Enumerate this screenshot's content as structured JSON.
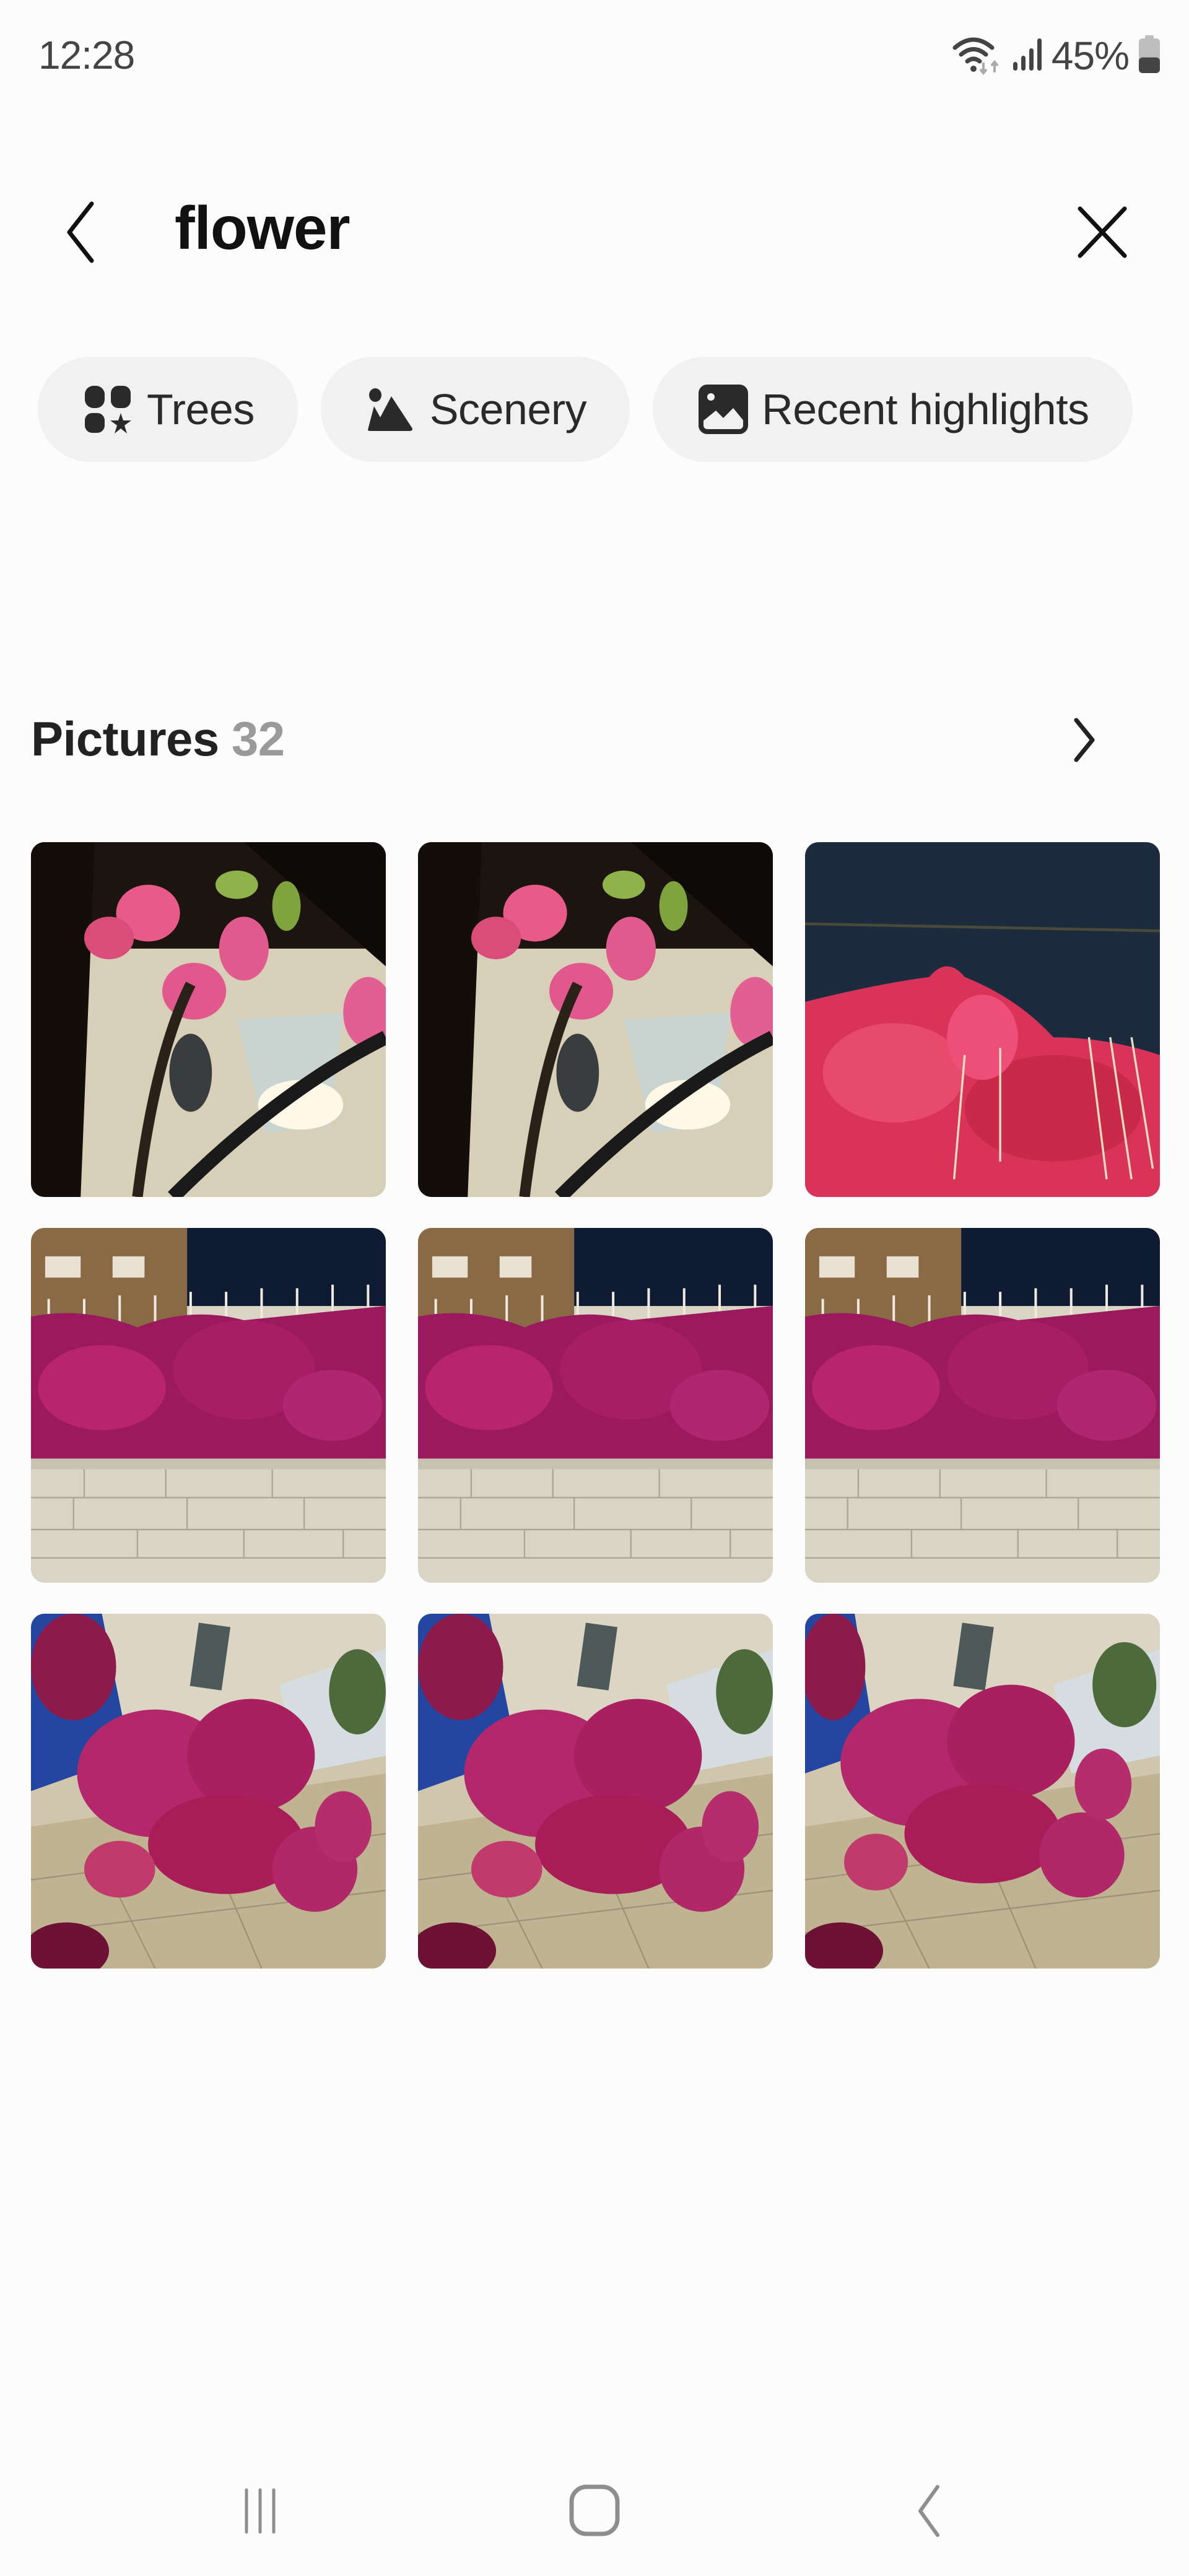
{
  "status_bar": {
    "time": "12:28",
    "battery_percent_label": "45%",
    "battery_level": 0.45,
    "icons": [
      "wifi-icon",
      "data-activity-icon",
      "signal-icon",
      "battery-icon"
    ]
  },
  "header": {
    "back_icon": "chevron-left-icon",
    "search_query": "flower",
    "clear_icon": "close-icon"
  },
  "suggestion_chips": [
    {
      "label": "Trees",
      "icon": "category-icon"
    },
    {
      "label": "Scenery",
      "icon": "landscape-icon"
    },
    {
      "label": "Recent highlights",
      "icon": "picture-icon"
    }
  ],
  "section": {
    "title": "Pictures",
    "count": "32",
    "more_icon": "chevron-right-icon"
  },
  "thumbnails": [
    {
      "subject": "pink bougainvillea by wall lamp at night"
    },
    {
      "subject": "pink bougainvillea by wall lamp at night"
    },
    {
      "subject": "red bougainvillea over fence under night sky"
    },
    {
      "subject": "magenta bougainvillea over railing on stone wall"
    },
    {
      "subject": "magenta bougainvillea over railing on stone wall"
    },
    {
      "subject": "magenta bougainvillea over railing on stone wall"
    },
    {
      "subject": "bougainvillea cluster against building"
    },
    {
      "subject": "bougainvillea cluster against building"
    },
    {
      "subject": "bougainvillea cluster against building"
    }
  ],
  "nav_bar": {
    "recents_icon": "recent-apps-icon",
    "home_icon": "home-icon",
    "back_icon": "back-icon"
  }
}
